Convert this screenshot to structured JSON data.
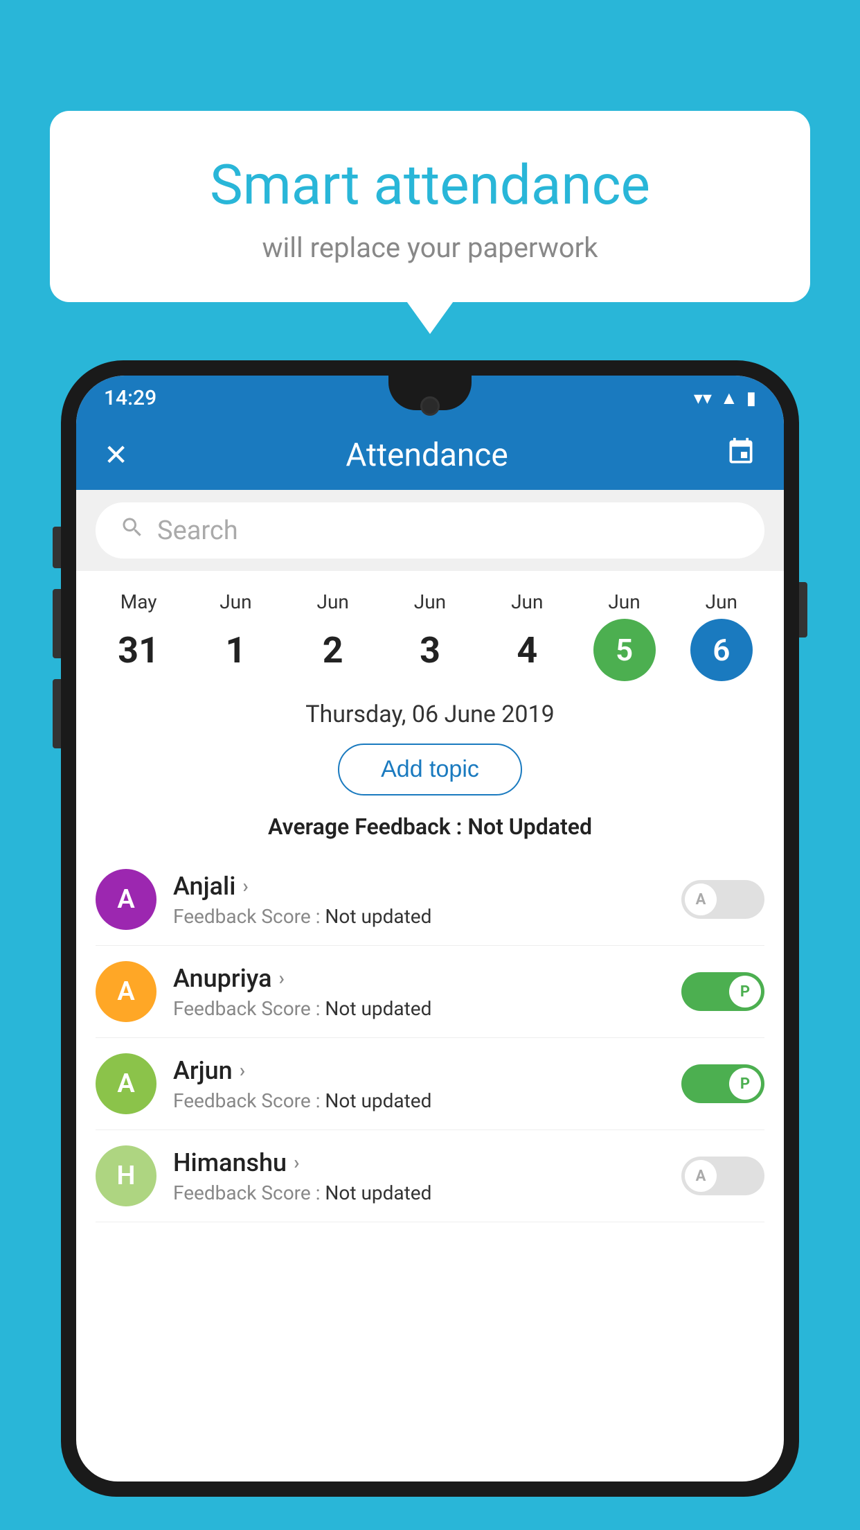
{
  "background": {
    "color": "#29b6d8"
  },
  "speech_bubble": {
    "title": "Smart attendance",
    "subtitle": "will replace your paperwork"
  },
  "status_bar": {
    "time": "14:29",
    "wifi_icon": "▼",
    "signal_icon": "▲",
    "battery_icon": "▮"
  },
  "header": {
    "title": "Attendance",
    "close_label": "✕",
    "calendar_icon": "📅"
  },
  "search": {
    "placeholder": "Search"
  },
  "calendar": {
    "dates": [
      {
        "month": "May",
        "day": "31",
        "style": "normal"
      },
      {
        "month": "Jun",
        "day": "1",
        "style": "normal"
      },
      {
        "month": "Jun",
        "day": "2",
        "style": "normal"
      },
      {
        "month": "Jun",
        "day": "3",
        "style": "normal"
      },
      {
        "month": "Jun",
        "day": "4",
        "style": "normal"
      },
      {
        "month": "Jun",
        "day": "5",
        "style": "today"
      },
      {
        "month": "Jun",
        "day": "6",
        "style": "selected"
      }
    ]
  },
  "selected_date": {
    "label": "Thursday, 06 June 2019"
  },
  "add_topic": {
    "label": "Add topic"
  },
  "avg_feedback": {
    "prefix": "Average Feedback : ",
    "value": "Not Updated"
  },
  "students": [
    {
      "name": "Anjali",
      "avatar_letter": "A",
      "avatar_color": "#9c27b0",
      "feedback_prefix": "Feedback Score : ",
      "feedback_value": "Not updated",
      "toggle": "off",
      "toggle_label": "A"
    },
    {
      "name": "Anupriya",
      "avatar_letter": "A",
      "avatar_color": "#ffa726",
      "feedback_prefix": "Feedback Score : ",
      "feedback_value": "Not updated",
      "toggle": "on",
      "toggle_label": "P"
    },
    {
      "name": "Arjun",
      "avatar_letter": "A",
      "avatar_color": "#8bc34a",
      "feedback_prefix": "Feedback Score : ",
      "feedback_value": "Not updated",
      "toggle": "on",
      "toggle_label": "P"
    },
    {
      "name": "Himanshu",
      "avatar_letter": "H",
      "avatar_color": "#aed581",
      "feedback_prefix": "Feedback Score : ",
      "feedback_value": "Not updated",
      "toggle": "off",
      "toggle_label": "A"
    }
  ]
}
